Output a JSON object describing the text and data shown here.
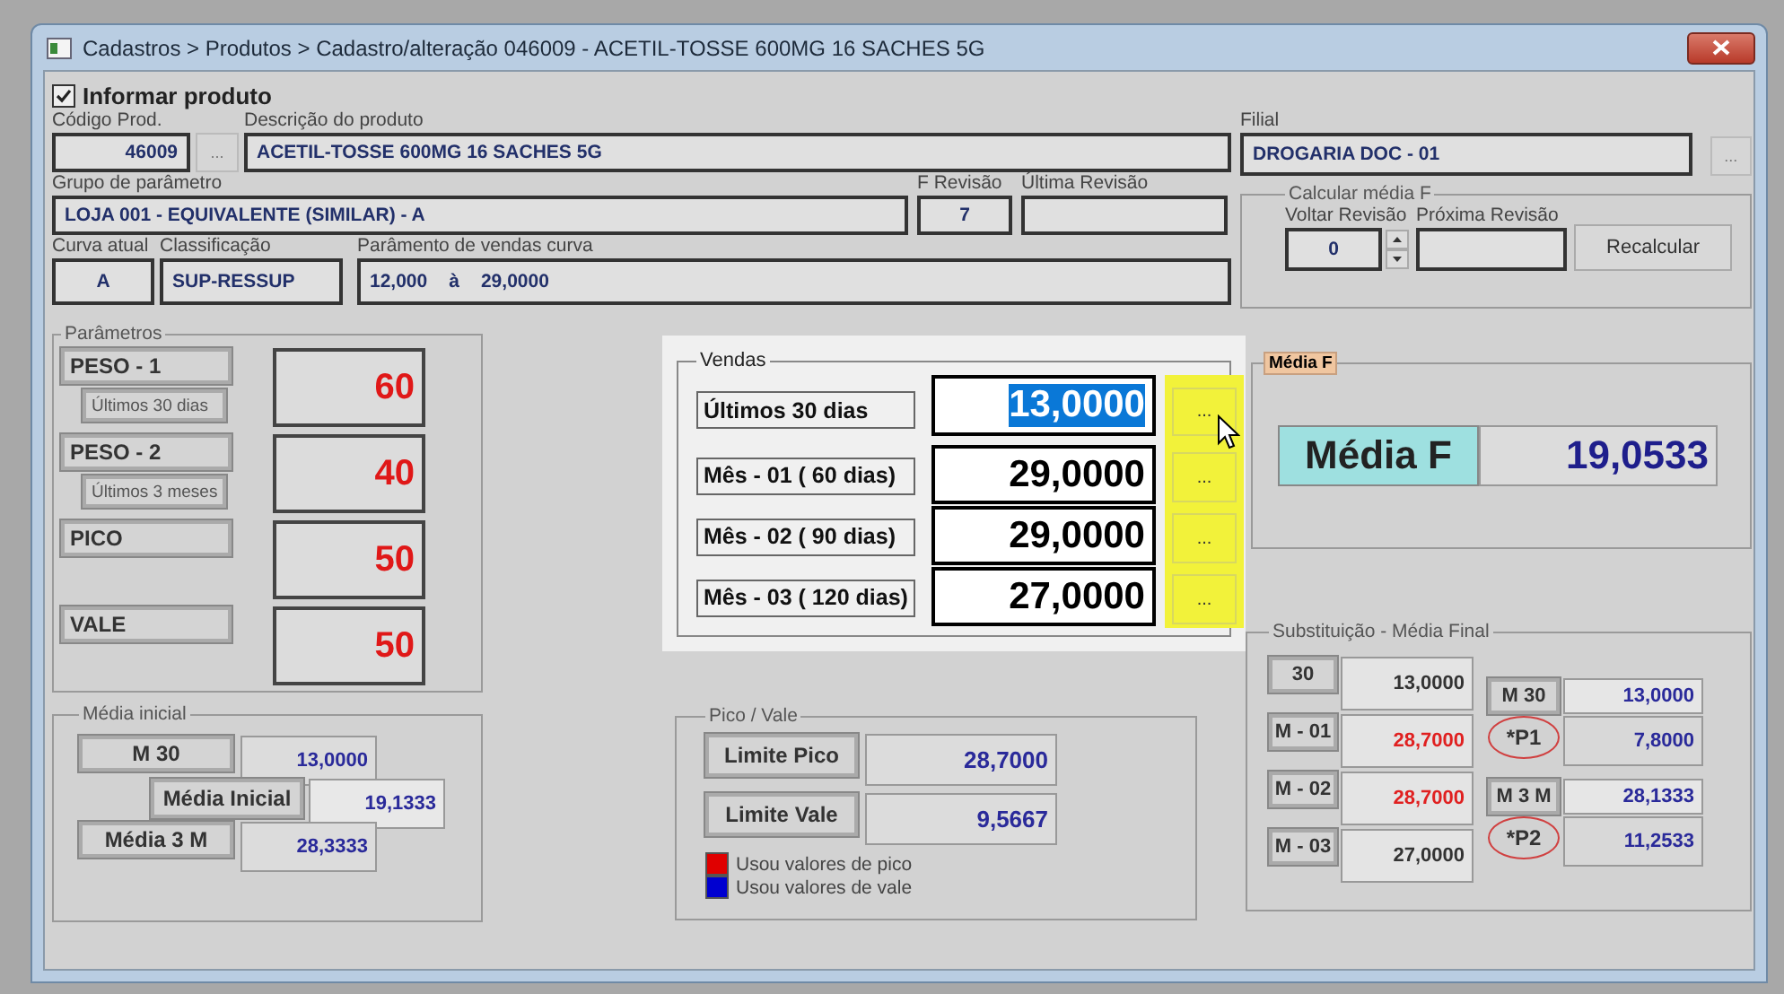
{
  "window": {
    "title": "Cadastros > Produtos > Cadastro/alteração  046009 - ACETIL-TOSSE 600MG 16 SACHES 5G"
  },
  "informar_produto": {
    "label": "Informar produto",
    "checked": true
  },
  "product": {
    "code_label": "Código Prod.",
    "code": "46009",
    "code_button": "...",
    "description_label": "Descrição do  produto",
    "description": "ACETIL-TOSSE 600MG 16 SACHES 5G",
    "branch_label": "Filial",
    "branch": "DROGARIA DOC - 01",
    "branch_button": "..."
  },
  "parameter_group": {
    "label": "Grupo de parâmetro",
    "value": "LOJA 001 - EQUIVALENTE (SIMILAR) - A"
  },
  "f_revision": {
    "label": "F Revisão",
    "value": "7"
  },
  "last_revision": {
    "label": "Última Revisão"
  },
  "calc": {
    "title": "Calcular média F",
    "back_label": "Voltar Revisão",
    "back_value": "0",
    "next_label": "Próxima Revisão",
    "button": "Recalcular"
  },
  "curve": {
    "label": "Curva atual",
    "value": "A"
  },
  "classification": {
    "label": "Classificação",
    "value": "SUP-RESSUP"
  },
  "sales_curve": {
    "label": "Parâmento de vendas curva",
    "from": "12,000",
    "sep": "à",
    "to": "29,0000"
  },
  "parametros": {
    "title": "Parâmetros",
    "items": [
      {
        "label": "PESO - 1",
        "note": "Últimos 30 dias",
        "value": "60"
      },
      {
        "label": "PESO - 2",
        "note": "Últimos 3 meses",
        "value": "40"
      },
      {
        "label": "PICO",
        "value": "50"
      },
      {
        "label": "VALE",
        "value": "50"
      }
    ]
  },
  "media_inicial": {
    "title": "Média inicial",
    "rows": [
      {
        "kind": "input",
        "label": "M 30",
        "value": "13,0000"
      },
      {
        "kind": "result",
        "label": "Média Inicial",
        "value": "19,1333"
      },
      {
        "kind": "input",
        "label": "Média 3 M",
        "value": "28,3333"
      }
    ]
  },
  "vendas": {
    "title": "Vendas",
    "rows": [
      {
        "label": "Últimos 30 dias",
        "value": "13,0000",
        "selected": true,
        "button": "..."
      },
      {
        "label": "Mês - 01 ( 60 dias)",
        "value": "29,0000",
        "selected": false,
        "button": "..."
      },
      {
        "label": "Mês - 02 ( 90 dias)",
        "value": "29,0000",
        "selected": false,
        "button": "..."
      },
      {
        "label": "Mês - 03 ( 120 dias)",
        "value": "27,0000",
        "selected": false,
        "button": "..."
      }
    ]
  },
  "pico_vale": {
    "title": "Pico / Vale",
    "rows": [
      {
        "label": "Limite Pico",
        "value": "28,7000"
      },
      {
        "label": "Limite Vale",
        "value": "9,5667"
      }
    ],
    "legend": [
      {
        "color": "#e00000",
        "label": "Usou valores de pico"
      },
      {
        "color": "#0000d0",
        "label": "Usou valores de vale"
      }
    ]
  },
  "media_f": {
    "title": "Média F",
    "label": "Média F",
    "value": "19,0533"
  },
  "substituicao": {
    "title": "Substituição - Média Final",
    "left": [
      {
        "label": "30",
        "value": "13,0000",
        "replaced": false
      },
      {
        "label": "M - 01",
        "value": "28,7000",
        "replaced": true
      },
      {
        "label": "M - 02",
        "value": "28,7000",
        "replaced": true
      },
      {
        "label": "M - 03",
        "value": "27,0000",
        "replaced": false
      }
    ],
    "right": [
      {
        "label": "M 30",
        "value": "13,0000",
        "circled": false
      },
      {
        "label": "*P1",
        "value": "7,8000",
        "circled": true
      },
      {
        "label": "M 3 M",
        "value": "28,1333",
        "circled": false
      },
      {
        "label": "*P2",
        "value": "11,2533",
        "circled": true
      }
    ]
  }
}
